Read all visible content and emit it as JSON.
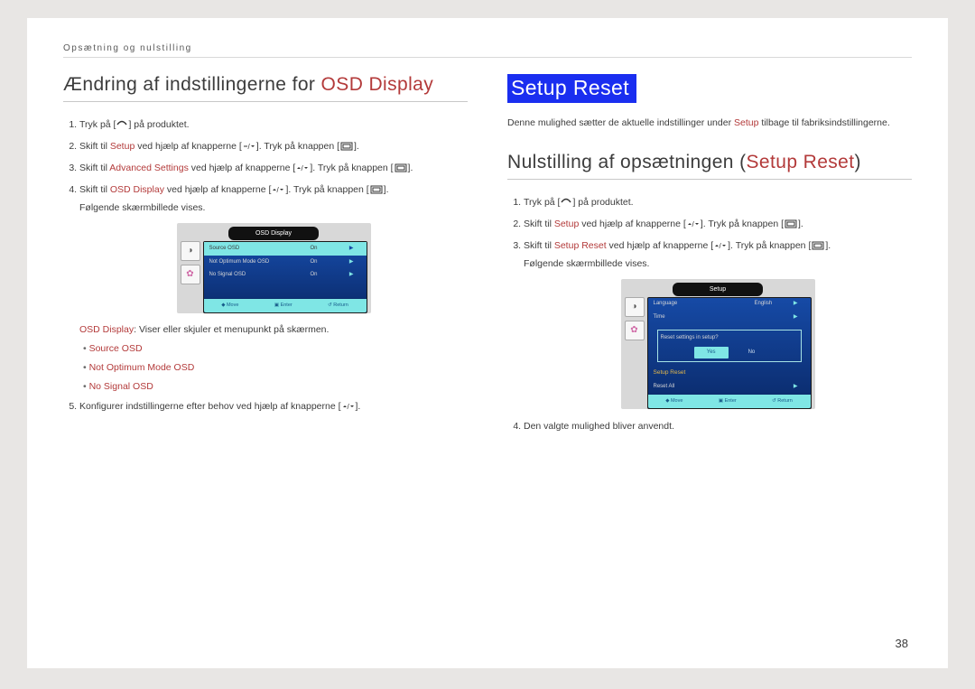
{
  "breadcrumb": "Opsætning og nulstilling",
  "pagenum": "38",
  "left": {
    "heading_a": "Ændring af indstillingerne for ",
    "heading_b": "OSD Display",
    "steps": {
      "s1a": "Tryk på [",
      "s1b": "] på produktet.",
      "s2a": "Skift til ",
      "s2b": "Setup",
      "s2c": " ved hjælp af knapperne [",
      "s2d": "]. Tryk på knappen [",
      "s2e": "].",
      "s3a": "Skift til ",
      "s3b": "Advanced Settings",
      "s3c": " ved hjælp af knapperne [",
      "s3d": "]. Tryk på knappen [",
      "s3e": "].",
      "s4a": "Skift til ",
      "s4b": "OSD Display",
      "s4c": " ved hjælp af knapperne [",
      "s4d": "]. Tryk på knappen [",
      "s4e": "].",
      "s4f": "Følgende skærmbillede vises.",
      "desc_a": "OSD Display",
      "desc_b": ": Viser eller skjuler et menupunkt på skærmen.",
      "b1": "Source OSD",
      "b2": "Not Optimum Mode OSD",
      "b3": "No Signal OSD",
      "s5a": "Konfigurer indstillingerne efter behov ved hjælp af knapperne [",
      "s5b": "]."
    },
    "osd": {
      "title": "OSD Display",
      "r1a": "Source OSD",
      "r1b": "On",
      "r2a": "Not Optimum Mode OSD",
      "r2b": "On",
      "r3a": "No Signal OSD",
      "r3b": "On",
      "f1": "Move",
      "f2": "Enter",
      "f3": "Return"
    }
  },
  "right": {
    "highlight": "Setup Reset",
    "intro_a": "Denne mulighed sætter de aktuelle indstillinger under ",
    "intro_b": "Setup",
    "intro_c": " tilbage til fabriksindstillingerne.",
    "heading_a": "Nulstilling af opsætningen (",
    "heading_b": "Setup Reset",
    "heading_c": ")",
    "steps": {
      "s1a": "Tryk på [",
      "s1b": "] på produktet.",
      "s2a": "Skift til ",
      "s2b": "Setup",
      "s2c": " ved hjælp af knapperne [",
      "s2d": "]. Tryk på knappen [",
      "s2e": "].",
      "s3a": "Skift til ",
      "s3b": "Setup Reset",
      "s3c": " ved hjælp af knapperne [",
      "s3d": "]. Tryk på knappen [",
      "s3e": "].",
      "s3f": "Følgende skærmbillede vises.",
      "s4": "Den valgte mulighed bliver anvendt."
    },
    "osd": {
      "title": "Setup",
      "r1a": "Language",
      "r1b": "English",
      "r2": "Time",
      "dialog_q": "Reset settings in setup?",
      "yes": "Yes",
      "no": "No",
      "r4": "Setup Reset",
      "r5": "Reset All",
      "f1": "Move",
      "f2": "Enter",
      "f3": "Return"
    }
  }
}
